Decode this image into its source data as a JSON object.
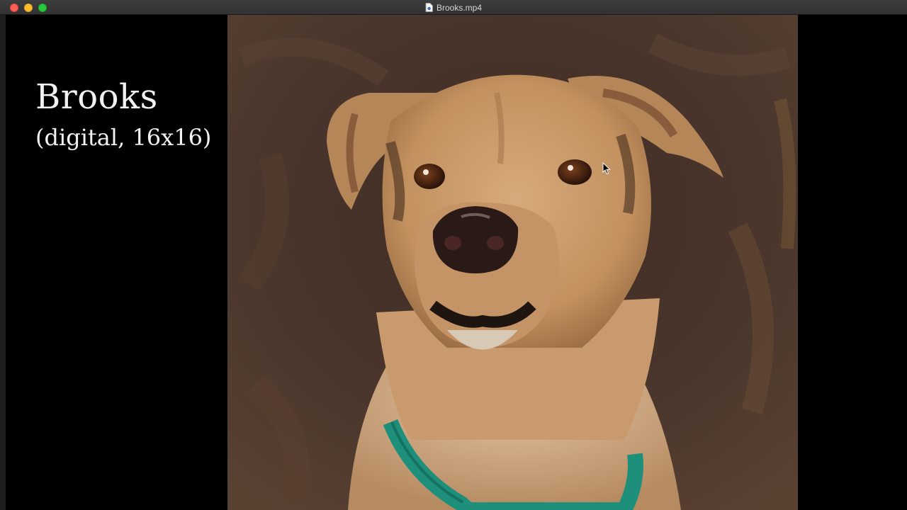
{
  "window": {
    "title": "Brooks.mp4"
  },
  "caption": {
    "title": "Brooks",
    "subtitle": "(digital, 16x16)"
  },
  "colors": {
    "background": "#000000",
    "titlebar": "#363636",
    "painting_background": "#4a362c",
    "collar": "#1e8f7a",
    "fur": "#c99a6e"
  },
  "icons": {
    "close": "close-traffic-light",
    "minimize": "minimize-traffic-light",
    "zoom": "zoom-traffic-light",
    "document": "document-icon",
    "cursor": "mouse-pointer-icon"
  }
}
